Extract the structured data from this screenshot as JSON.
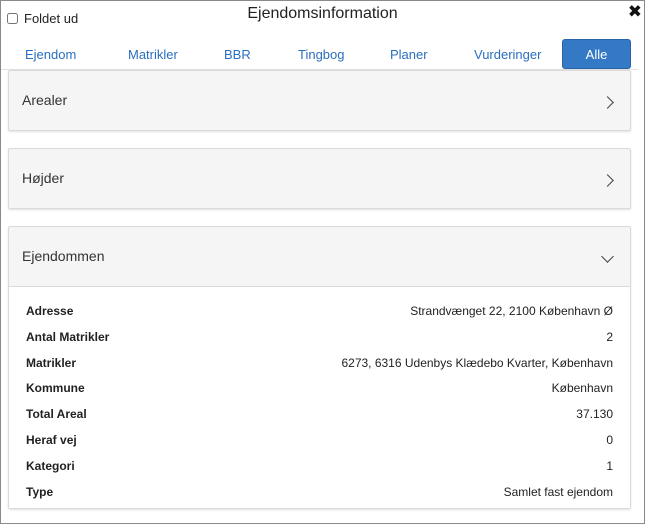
{
  "header": {
    "folded_label": "Foldet ud",
    "title": "Ejendomsinformation",
    "close_glyph": "✖"
  },
  "tabs": [
    {
      "label": "Ejendom"
    },
    {
      "label": "Matrikler"
    },
    {
      "label": "BBR"
    },
    {
      "label": "Tingbog"
    },
    {
      "label": "Planer"
    },
    {
      "label": "Vurderinger"
    },
    {
      "label": "Alle",
      "active": true
    }
  ],
  "panels": {
    "arealer": {
      "title": "Arealer",
      "expanded": false
    },
    "hojder": {
      "title": "Højder",
      "expanded": false
    },
    "ejendommen": {
      "title": "Ejendommen",
      "expanded": true,
      "rows": [
        {
          "key": "Adresse",
          "value": "Strandvænget 22, 2100 København Ø"
        },
        {
          "key": "Antal Matrikler",
          "value": "2"
        },
        {
          "key": "Matrikler",
          "value": "6273, 6316 Udenbys Klædebo Kvarter, København"
        },
        {
          "key": "Kommune",
          "value": "København"
        },
        {
          "key": "Total Areal",
          "value": "37.130"
        },
        {
          "key": "Heraf vej",
          "value": "0"
        },
        {
          "key": "Kategori",
          "value": "1"
        },
        {
          "key": "Type",
          "value": "Samlet fast ejendom"
        }
      ]
    }
  },
  "colors": {
    "accent": "#3479c6",
    "tab_text": "#2a6fbf",
    "panel_bg": "#f5f5f5"
  }
}
